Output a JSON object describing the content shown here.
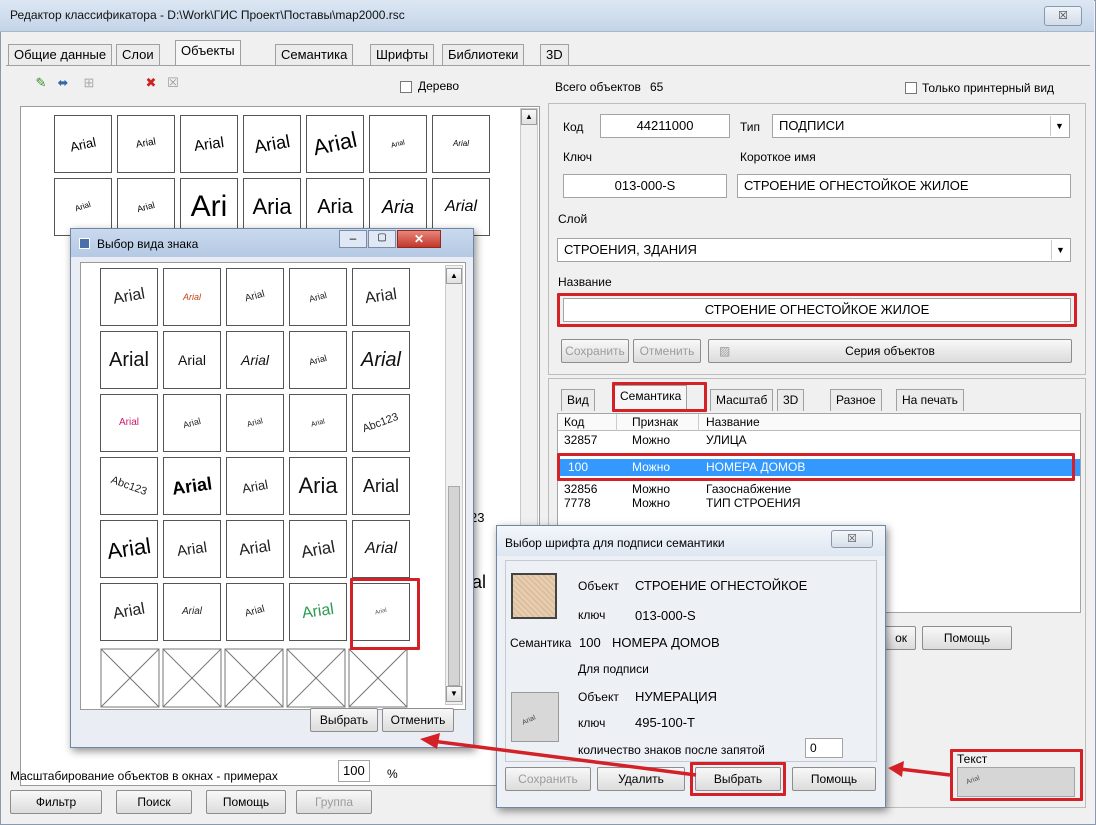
{
  "window": {
    "title": "Редактор классификатора - D:\\Work\\ГИС Проект\\Поставы\\map2000.rsc",
    "close": "☒"
  },
  "tabs": [
    "Общие данные",
    "Слои",
    "Объекты",
    "Семантика",
    "Шрифты",
    "Библиотеки",
    "3D"
  ],
  "toolbar": {
    "tree_label": "Дерево"
  },
  "grid": {
    "rows": [
      [
        "Arial",
        "Arial",
        "Arial",
        "Arial",
        "Arial",
        "Arial",
        "Arial"
      ],
      [
        "Arial",
        "Arial",
        "Ari",
        "Aria",
        "Aria",
        "Aria",
        "Arial"
      ]
    ],
    "right_edge_samples": [
      "23",
      "al"
    ]
  },
  "objects_info": {
    "total_label": "Всего объектов",
    "total_value": "65",
    "printer_only_label": "Только принтерный вид",
    "code_label": "Код",
    "code_value": "44211000",
    "type_label": "Тип",
    "type_value": "ПОДПИСИ",
    "key_label": "Ключ",
    "key_value": "013-000-S",
    "short_name_label": "Короткое имя",
    "short_name_value": "СТРОЕНИЕ ОГНЕСТОЙКОЕ ЖИЛОЕ",
    "layer_label": "Слой",
    "layer_value": "СТРОЕНИЯ, ЗДАНИЯ",
    "name_label": "Название",
    "name_value": "СТРОЕНИЕ ОГНЕСТОЙКОЕ ЖИЛОЕ",
    "save": "Сохранить",
    "cancel": "Отменить",
    "series": "Серия объектов"
  },
  "subtabs": [
    "Вид",
    "Семантика",
    "Масштаб",
    "3D",
    "Разное",
    "На печать"
  ],
  "semantics_table": {
    "headers": [
      "Код",
      "Признак",
      "Название"
    ],
    "rows": [
      [
        "32857",
        "Можно",
        "УЛИЦА"
      ],
      [
        "100",
        "Можно",
        "НОМЕРА ДОМОВ"
      ],
      [
        "32856",
        "Можно",
        "Газоснабжение"
      ],
      [
        "7778",
        "Можно",
        "ТИП СТРОЕНИЯ"
      ]
    ]
  },
  "partial_buttons": {
    "ok_tail": "ок",
    "help": "Помощь"
  },
  "text_panel": {
    "label": "Текст",
    "sample": "Arial"
  },
  "bottom": {
    "scale_label": "Масштабирование объектов в окнах - примерах",
    "scale_value": "100",
    "scale_unit": "%",
    "filter": "Фильтр",
    "search": "Поиск",
    "help": "Помощь",
    "group": "Группа"
  },
  "sign_dialog": {
    "title": "Выбор вида знака",
    "rows": [
      [
        "Arial",
        "Arial",
        "Arial",
        "Arial",
        "Arial"
      ],
      [
        "Arial",
        "Arial",
        "Arial",
        "Arial",
        "Arial"
      ],
      [
        "Arial",
        "Arial",
        "Arial",
        "Arial",
        "Abc123"
      ],
      [
        "Abc123",
        "Arial",
        "Arial",
        "Aria",
        "Arial"
      ],
      [
        "Arial",
        "Arial",
        "Arial",
        "Arial",
        "Arial"
      ],
      [
        "Arial",
        "Arial",
        "Arial",
        "Arial",
        "Arial"
      ]
    ],
    "select": "Выбрать",
    "cancel": "Отменить"
  },
  "font_dialog": {
    "title": "Выбор шрифта для подписи семантики",
    "object_label": "Объект",
    "object_value": "СТРОЕНИЕ ОГНЕСТОЙКОЕ",
    "key_label": "ключ",
    "key_value": "013-000-S",
    "semantic_label": "Семантика",
    "semantic_code": "100",
    "semantic_name": "НОМЕРА ДОМОВ",
    "for_caption": "Для подписи",
    "obj2_label": "Объект",
    "obj2_value": "НУМЕРАЦИЯ",
    "key2_label": "ключ",
    "key2_value": "495-100-Т",
    "decimals_label": "количество знаков после запятой",
    "decimals_value": "0",
    "sample": "Arial",
    "save": "Сохранить",
    "delete": "Удалить",
    "select": "Выбрать",
    "help": "Помощь",
    "close": "☒"
  },
  "colors": {
    "accent_red": "#d42027",
    "selection_blue": "#3399ff"
  }
}
